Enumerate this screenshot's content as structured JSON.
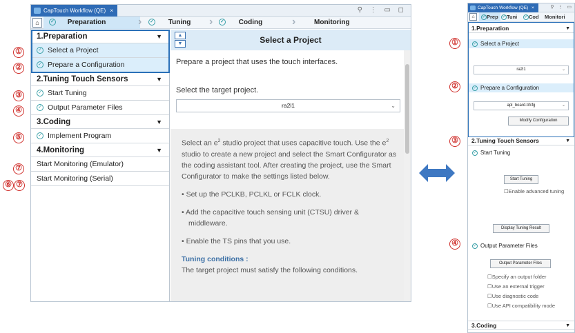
{
  "left_window": {
    "tab_title": "CapTouch Workflow (QE)",
    "tab_close": "×",
    "window_controls": "⚲ ⋮ ▭ ◻",
    "flow": {
      "home_icon": "home-icon",
      "steps": [
        "Preparation",
        "Tuning",
        "Coding",
        "Monitoring"
      ]
    },
    "sidebar": {
      "sections": [
        {
          "label": "1.Preparation",
          "items": [
            "Select a Project",
            "Prepare a Configuration"
          ]
        },
        {
          "label": "2.Tuning Touch Sensors",
          "items": [
            "Start Tuning",
            "Output Parameter Files"
          ]
        },
        {
          "label": "3.Coding",
          "items": [
            "Implement Program"
          ]
        },
        {
          "label": "4.Monitoring",
          "items": [
            "Start Monitoring (Emulator)",
            "Start Monitoring (Serial)"
          ]
        }
      ]
    },
    "main": {
      "title": "Select a Project",
      "intro": "Prepare a project that uses the touch interfaces.",
      "target_label": "Select the target project.",
      "target_value": "ra2l1",
      "desc_part1": "Select an e",
      "desc_sup": "2",
      "desc_part2": " studio project that uses capacitive touch. Use the e",
      "desc_sup2": "2",
      "desc_part3": " studio to create a new project and select the Smart Configurator as the coding assistant tool. After creating the project, use the Smart Configurator to make the settings listed below.",
      "bullets": [
        "Set up the PCLKB, PCLKL or FCLK clock.",
        "Add the capacitive touch sensing unit (CTSU) driver & middleware.",
        "Enable the TS pins that you use."
      ],
      "tuning_heading": "Tuning conditions :",
      "tuning_text": "The target project must satisfy the following conditions."
    }
  },
  "callouts_left": [
    "①",
    "②",
    "③",
    "④",
    "⑤",
    "⑦",
    "⑥",
    "⑦"
  ],
  "callouts_right": [
    "①",
    "②",
    "③",
    "④"
  ],
  "right_panel": {
    "tab_title": "CapTouch Workflow (QE)",
    "tab_close": "×",
    "window_controls": "⚲ ⋮ ▭",
    "flow_steps": [
      "Prep",
      "Tuni",
      "Cod",
      "Monitori"
    ],
    "sec1": "1.Preparation",
    "item_select_project": "Select a Project",
    "project_value": "ra2l1",
    "item_prepare_config": "Prepare a Configuration",
    "config_value": "apl_board.tifcfg",
    "modify_config_btn": "Modify Configuration",
    "sec2": "2.Tuning Touch Sensors",
    "item_start_tuning": "Start Tuning",
    "start_tuning_btn": "Start Tuning",
    "enable_advanced": "☐Enable advanced tuning",
    "display_result_btn": "Display Tuning Result",
    "item_output_params": "Output Parameter Files",
    "output_params_btn": "Output Parameter Files",
    "opt_output_folder": "☐Specify an output folder",
    "opt_external_trigger": "☐Use an external trigger",
    "opt_diagnostic": "☐Use diagnostic code",
    "opt_api_compat": "☐Use API compatibility mode",
    "sec3": "3.Coding"
  },
  "colors": {
    "accent_blue": "#2a70b8",
    "callout_red": "#d0312d",
    "arrow_blue": "#3e78c2"
  }
}
